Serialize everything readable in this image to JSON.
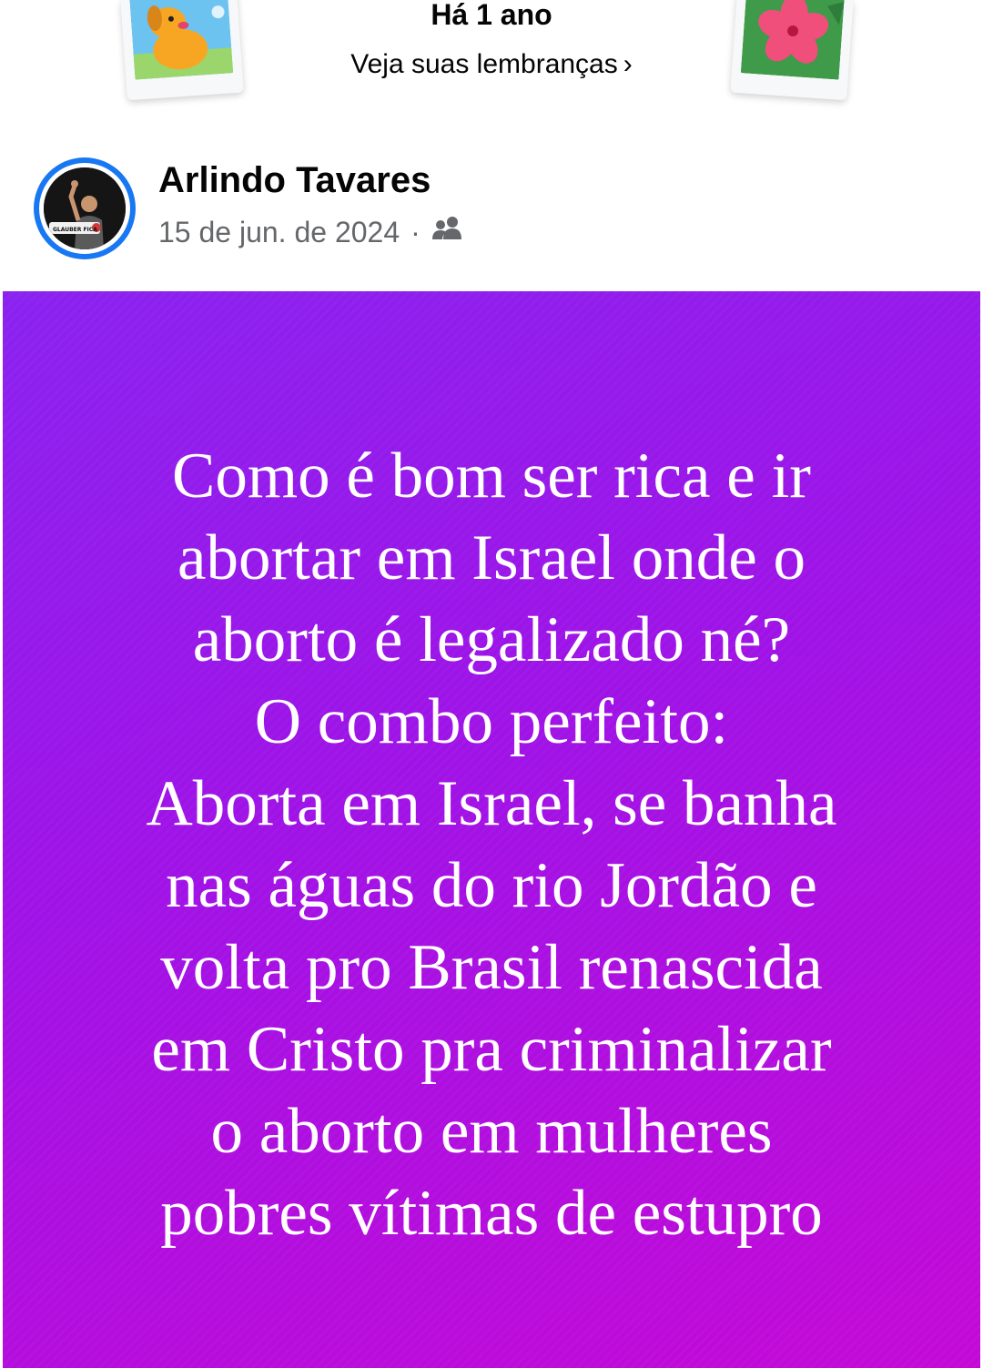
{
  "memories": {
    "title": "Há 1 ano",
    "link_label": "Veja suas lembranças",
    "link_chevron": "›",
    "left_card_icon": "dog-illustration-icon",
    "right_card_icon": "hibiscus-flower-icon"
  },
  "post": {
    "author": "Arlindo Tavares",
    "avatar_badge_text": "GLAUBER FICA",
    "date": "15 de jun. de 2024",
    "separator": "·",
    "audience_icon": "friends-icon",
    "image": {
      "background_colors": [
        "#8a22f0",
        "#c409d6"
      ],
      "lines": [
        "Como é bom ser rica e ir",
        "abortar em Israel onde o",
        "aborto é legalizado né?",
        "O combo perfeito:",
        "Aborta em Israel, se banha",
        "nas águas do rio Jordão e",
        "volta pro Brasil renascida",
        "em Cristo pra criminalizar",
        "o aborto em mulheres",
        "pobres vítimas de estupro"
      ]
    }
  },
  "colors": {
    "accent": "#1877f2",
    "text_primary": "#050505",
    "text_secondary": "#65676b"
  }
}
